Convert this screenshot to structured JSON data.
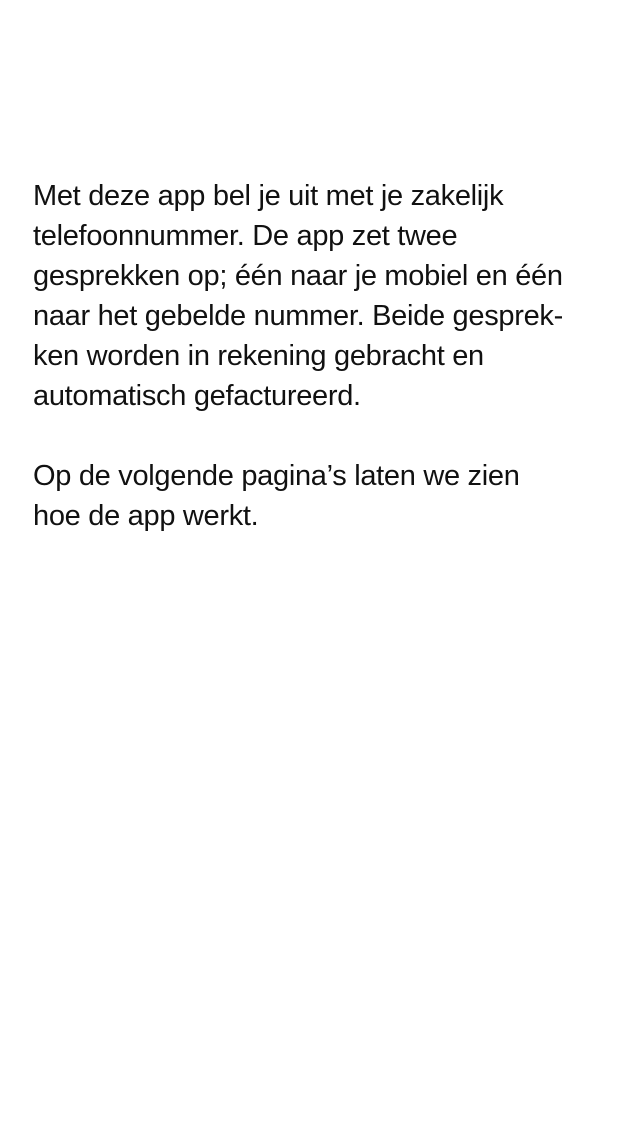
{
  "intro": {
    "paragraph1": [
      "Met deze app bel je uit met je zakelijk",
      "telefoonnummer. De app zet twee",
      "gesprekken op; één naar je mobiel en één",
      "naar het gebelde nummer. Beide gesprek-",
      "ken worden in rekening gebracht en",
      "automatisch gefactureerd."
    ],
    "paragraph2": [
      "Op de volgende pagina’s laten we zien",
      "hoe de app werkt."
    ]
  }
}
